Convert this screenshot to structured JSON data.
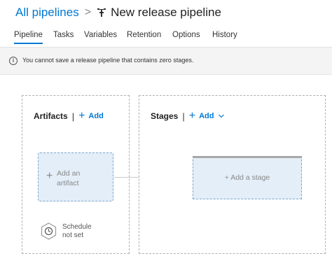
{
  "breadcrumb": {
    "parent": "All pipelines",
    "separator": ">",
    "title": "New release pipeline"
  },
  "tabs": [
    {
      "label": "Pipeline",
      "active": true
    },
    {
      "label": "Tasks"
    },
    {
      "label": "Variables"
    },
    {
      "label": "Retention"
    },
    {
      "label": "Options"
    },
    {
      "label": "History"
    }
  ],
  "info_bar": {
    "icon": "info-icon",
    "message": "You cannot save a release pipeline that contains zero stages."
  },
  "artifacts": {
    "title": "Artifacts",
    "separator": "|",
    "add_label": "Add",
    "add_artifact_line1": "Add an",
    "add_artifact_line2": "artifact",
    "schedule_line1": "Schedule",
    "schedule_line2": "not set"
  },
  "stages": {
    "title": "Stages",
    "separator": "|",
    "add_label": "Add",
    "add_stage_label": "Add a stage"
  },
  "colors": {
    "accent": "#0078d4",
    "info_bar_bg": "#f4f4f4",
    "placeholder_bg": "#e4eef8"
  }
}
